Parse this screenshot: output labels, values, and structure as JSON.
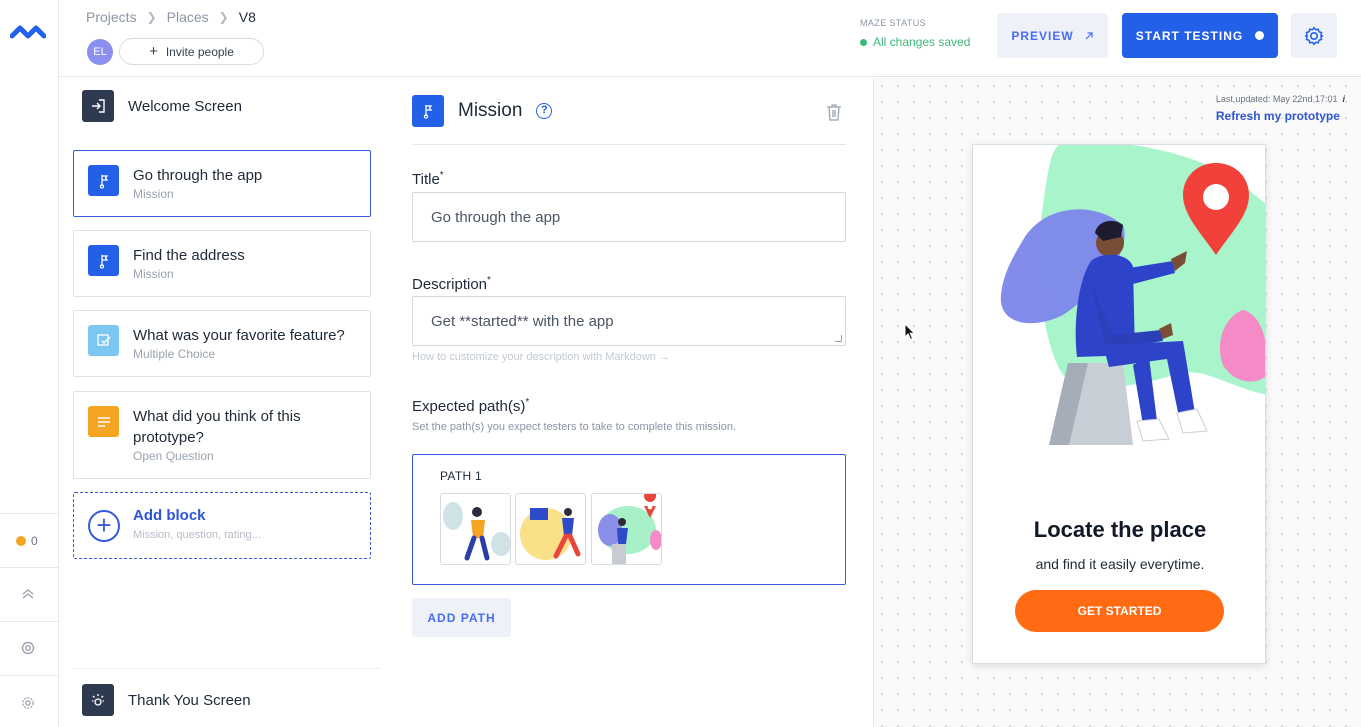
{
  "header": {
    "breadcrumb": [
      "Projects",
      "Places",
      "V8"
    ],
    "avatar_initials": "EL",
    "invite_label": "Invite people",
    "status_label": "MAZE STATUS",
    "status_value": "All changes saved",
    "preview_label": "PREVIEW",
    "start_label": "START TESTING"
  },
  "rail": {
    "notification_count": "0"
  },
  "blocks": {
    "welcome": "Welcome Screen",
    "items": [
      {
        "title": "Go through the app",
        "type": "Mission",
        "icon": "flag-icon",
        "color": "#2360e8"
      },
      {
        "title": "Find the address",
        "type": "Mission",
        "icon": "flag-icon",
        "color": "#2360e8"
      },
      {
        "title": "What was your favorite feature?",
        "type": "Multiple Choice",
        "icon": "checklist-icon",
        "color": "#7cc7f2"
      },
      {
        "title": "What did you think of this prototype?",
        "type": "Open Question",
        "icon": "text-lines-icon",
        "color": "#f5a524"
      }
    ],
    "add_title": "Add block",
    "add_sub": "Mission, question, rating...",
    "thank_you": "Thank You Screen"
  },
  "editor": {
    "heading": "Mission",
    "title_label": "Title",
    "title_value": "Go through the app",
    "desc_label": "Description",
    "desc_value": "Get **started** with the app",
    "desc_hint": "How to customize your description with Markdown →",
    "paths_label": "Expected path(s)",
    "paths_sub": "Set the path(s) you expect testers to take to complete this mission.",
    "path_name": "PATH 1",
    "add_path": "ADD PATH"
  },
  "preview": {
    "updated": "Last updated: May 22nd 17:01",
    "refresh": "Refresh my prototype",
    "screen_title": "Locate the place",
    "screen_sub": "and find it easily everytime.",
    "screen_button": "GET STARTED"
  },
  "colors": {
    "primary": "#2360e8",
    "success": "#3cb878",
    "cta": "#ff6a13"
  }
}
